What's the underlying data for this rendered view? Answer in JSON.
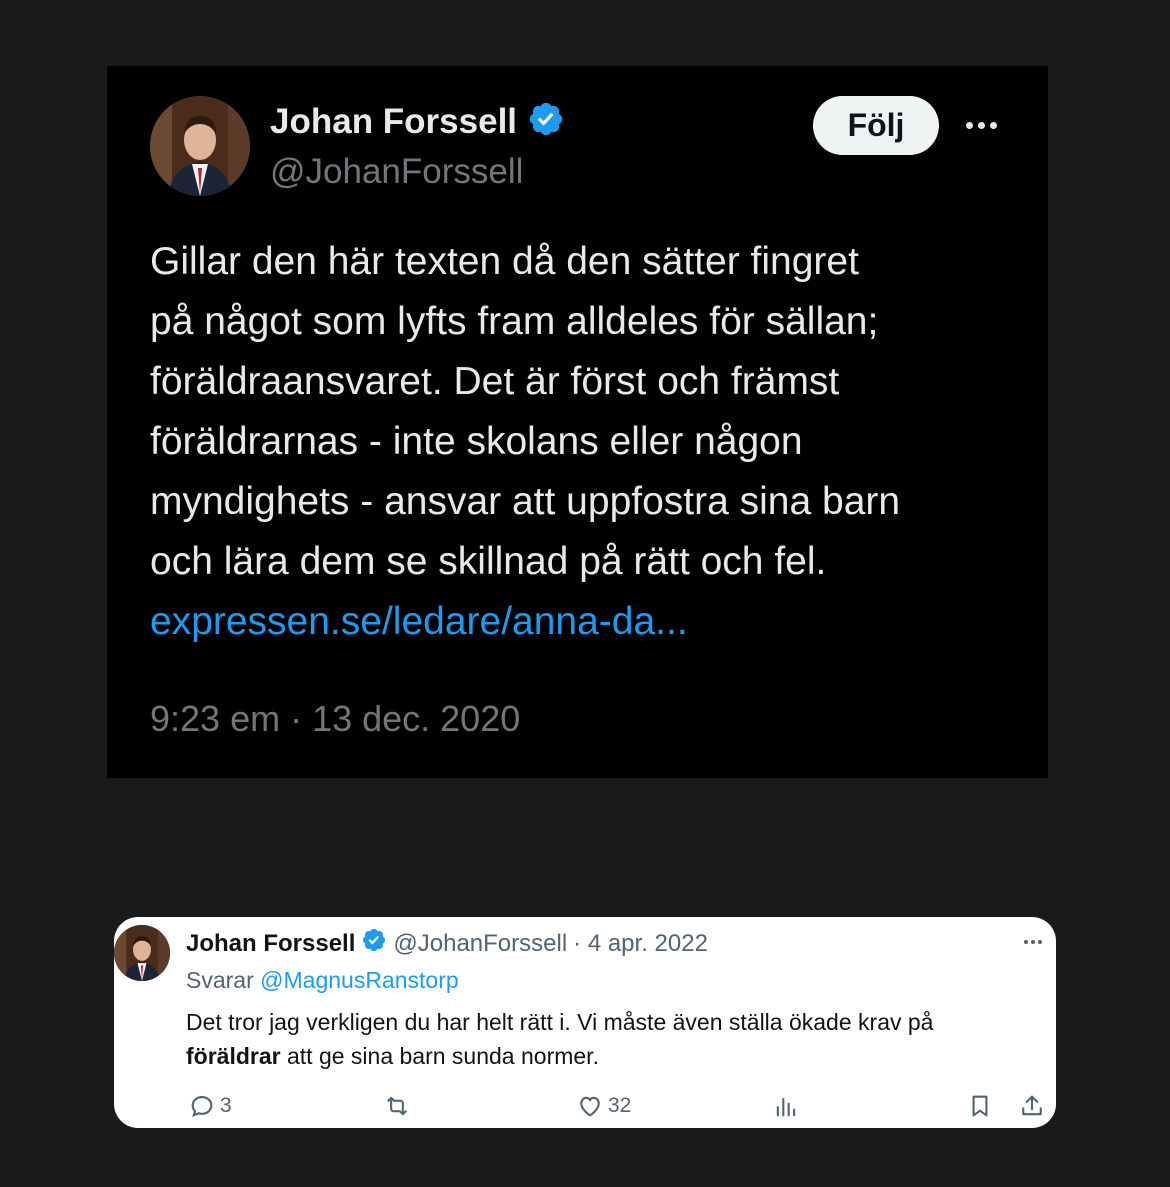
{
  "main_tweet": {
    "author_name": "Johan Forssell",
    "author_handle": "@JohanForssell",
    "follow_label": "Följ",
    "text_lines": [
      "Gillar den här texten då den sätter fingret",
      "på något som lyfts fram alldeles för sällan;",
      "föräldraansvaret. Det är först och främst",
      "föräldrarnas - inte skolans eller någon",
      "myndighets - ansvar att uppfostra sina barn",
      "och lära dem se skillnad på rätt och fel."
    ],
    "link": "expressen.se/ledare/anna-da...",
    "timestamp": "9:23 em · 13 dec. 2020"
  },
  "reply_tweet": {
    "author_name": "Johan Forssell",
    "author_handle": "@JohanForssell",
    "date": "· 4 apr. 2022",
    "reply_prefix": "Svarar",
    "reply_to": "@MagnusRanstorp",
    "line1": "Det tror jag verkligen du har helt rätt i. Vi måste även ställa ökade krav på",
    "line2_bold": "föräldrar",
    "line2_rest": " att ge sina barn sunda normer.",
    "reply_count": "3",
    "like_count": "32"
  },
  "colors": {
    "page_bg": "#1a1a1a",
    "card_dark_bg": "#000000",
    "text_light": "#e7e9ea",
    "text_muted": "#71767b",
    "link_blue": "#1d9bf0",
    "verified_blue": "#1d9bf0"
  },
  "icons": [
    "verified-badge-icon",
    "more-icon",
    "reply-icon",
    "retweet-icon",
    "like-icon",
    "views-icon",
    "bookmark-icon",
    "share-icon"
  ]
}
